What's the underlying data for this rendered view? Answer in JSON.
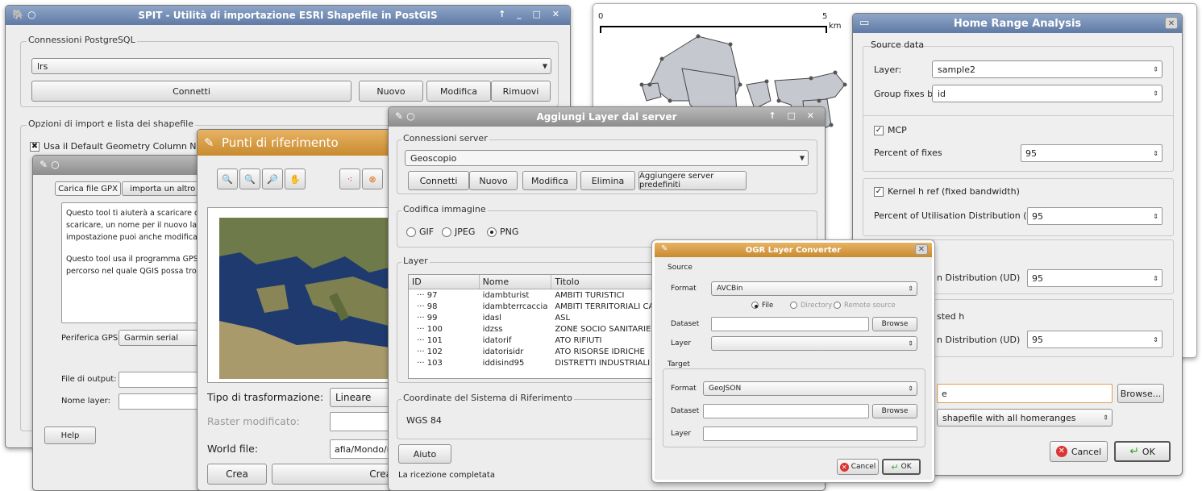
{
  "spit": {
    "title": "SPIT - Utilità di importazione ESRI Shapefile in PostGIS",
    "conn_group": "Connessioni PostgreSQL",
    "conn_value": "lrs",
    "connect": "Connetti",
    "new": "Nuovo",
    "edit": "Modifica",
    "remove": "Rimuovi",
    "opts_group": "Opzioni di import e lista dei shapefile",
    "default_geom": "Usa il Default Geometry Column Name"
  },
  "gps": {
    "tab1": "Carica file GPX",
    "tab2": "importa un altro file",
    "p1a": "Questo tool ti aiuterà a scaricare dati d",
    "p1b": "scaricare, un nome per il nuovo layer e",
    "p1c": "impostazione puoi anche modificare i d",
    "p2a": "Questo tool usa il programma GPSBa",
    "p2b": "percorso nel quale QGIS possa trovar",
    "device_label": "Periferica GPS:",
    "device_value": "Garmin serial",
    "output_label": "File di output:",
    "layername_label": "Nome layer:",
    "help": "Help"
  },
  "georef": {
    "title": "Punti di riferimento",
    "transform_label": "Tipo di trasformazione:",
    "transform_value": "Lineare",
    "raster_label": "Raster modificato:",
    "world_label": "World file:",
    "world_value": "afia/Mondo/m",
    "create": "Crea",
    "create2": "Crea"
  },
  "wms": {
    "title": "Aggiungi Layer dal server",
    "conn_group": "Connessioni server",
    "server": "Geoscopio",
    "connect": "Connetti",
    "new": "Nuovo",
    "edit": "Modifica",
    "delete": "Elimina",
    "add_default": "Aggiungere server predefiniti",
    "encoding_group": "Codifica immagine",
    "gif": "GIF",
    "jpeg": "JPEG",
    "png": "PNG",
    "layer_group": "Layer",
    "col_id": "ID",
    "col_name": "Nome",
    "col_title": "Titolo",
    "rows": [
      [
        "97",
        "idambturist",
        "AMBITI TURISTICI"
      ],
      [
        "98",
        "idambterrcaccia",
        "AMBITI TERRITORIALI CA"
      ],
      [
        "99",
        "idasl",
        "ASL"
      ],
      [
        "100",
        "idzss",
        "ZONE SOCIO SANITARIE"
      ],
      [
        "101",
        "idatorif",
        "ATO RIFIUTI"
      ],
      [
        "102",
        "idatorisidr",
        "ATO RISORSE IDRICHE"
      ],
      [
        "103",
        "iddisind95",
        "DISTRETTI INDUSTRIALI S"
      ]
    ],
    "crs_group": "Coordinate del Sistema di Riferimento",
    "crs_value": "WGS 84",
    "help": "Aiuto",
    "status": "La ricezione completata"
  },
  "map": {
    "scale_start": "0",
    "scale_end": "5",
    "scale_unit": "km"
  },
  "hr": {
    "title": "Home Range Analysis",
    "source_group": "Source data",
    "layer_label": "Layer:",
    "layer_value": "sample2",
    "group_label": "Group fixes by",
    "group_value": "id",
    "mcp": "MCP",
    "percent_fixes_label": "Percent of fixes",
    "percent_fixes_value": "95",
    "kernel": "Kernel h ref (fixed bandwidth)",
    "ud_label": "Percent of Utilisation Distribution (UD)",
    "ud_value": "95",
    "ud2_label": "n Distribution (UD)",
    "ud2_value": "95",
    "adjusted_label": "sted h",
    "ud3_label": "n Distribution (UD)",
    "ud3_value": "95",
    "output_value": "e",
    "browse": "Browse...",
    "output_mode": "shapefile with all homeranges",
    "cancel": "Cancel",
    "ok": "OK"
  },
  "ogr": {
    "title": "OGR Layer Converter",
    "source": "Source",
    "format_label": "Format",
    "format_value": "AVCBin",
    "file": "File",
    "directory": "Directory",
    "remote": "Remote source",
    "dataset_label": "Dataset",
    "browse": "Browse",
    "layer_label": "Layer",
    "target": "Target",
    "target_format_value": "GeoJSON",
    "cancel": "Cancel",
    "ok": "OK"
  }
}
